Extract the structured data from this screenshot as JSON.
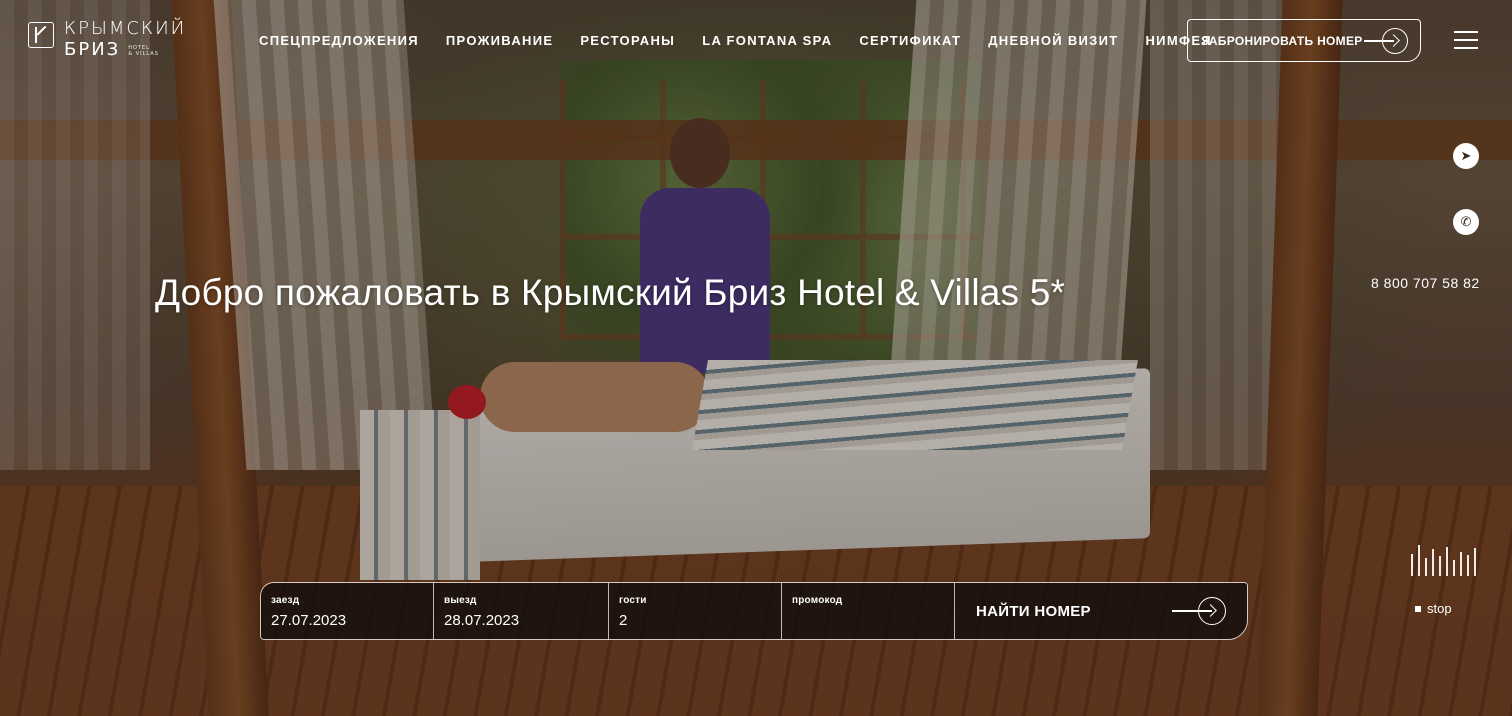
{
  "brand": {
    "name_line1": "КРЫМСКИЙ",
    "name_line2": "БРИЗ",
    "sub_line1": "HOTEL",
    "sub_line2": "& VILLAS"
  },
  "nav": {
    "items": [
      {
        "label": "СПЕЦПРЕДЛОЖЕНИЯ"
      },
      {
        "label": "ПРОЖИВАНИЕ"
      },
      {
        "label": "РЕСТОРАНЫ"
      },
      {
        "label": "LA FONTANA SPA"
      },
      {
        "label": "СЕРТИФИКАТ"
      },
      {
        "label": "ДНЕВНОЙ ВИЗИТ"
      },
      {
        "label": "НИМФЕЯ"
      }
    ],
    "book_button": "ЗАБРОНИРОВАТЬ НОМЕР"
  },
  "hero": {
    "title": "Добро пожаловать в Крымский Бриз Hotel & Villas 5*"
  },
  "contacts": {
    "phone": "8 800 707 58 82",
    "telegram_icon": "telegram-icon",
    "whatsapp_icon": "whatsapp-icon"
  },
  "video": {
    "stop_label": "stop"
  },
  "booking": {
    "checkin_label": "заезд",
    "checkin_value": "27.07.2023",
    "checkout_label": "выезд",
    "checkout_value": "28.07.2023",
    "guests_label": "гости",
    "guests_value": "2",
    "promo_label": "промокод",
    "promo_value": "",
    "find_button": "НАЙТИ НОМЕР"
  }
}
